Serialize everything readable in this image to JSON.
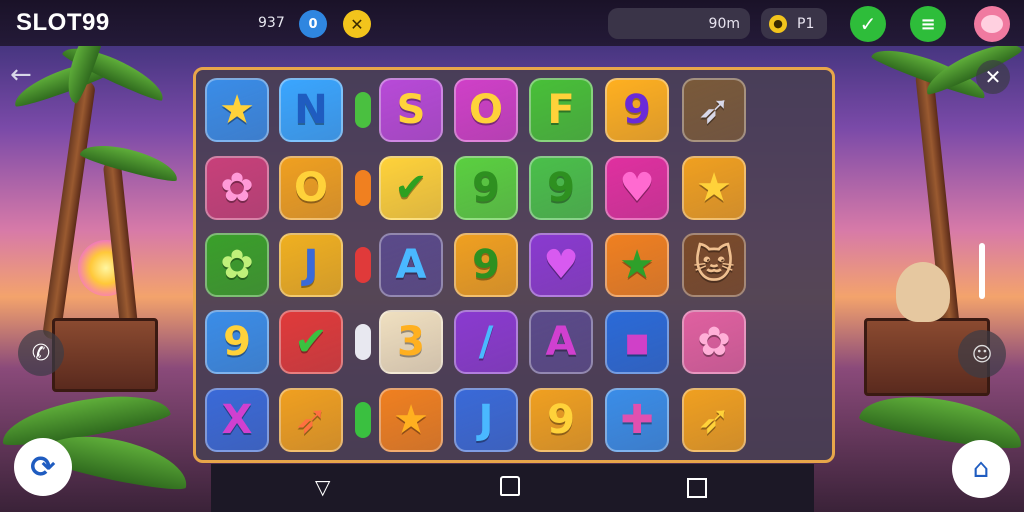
{
  "app": {
    "logo": "SLOT99"
  },
  "topbar": {
    "coin_count": "937",
    "blue_badge": "0",
    "balance": "90m",
    "message_label": "P1"
  },
  "icons": {
    "back": "arrow-left-icon",
    "close": "close-icon",
    "phone": "phone-icon",
    "refresh": "refresh-icon",
    "bag": "bag-icon",
    "check": "check-icon",
    "menu": "menu-icon",
    "avatar": "pig-avatar-icon"
  },
  "colors": {
    "accent_green": "#2ebd3a",
    "gold": "#e8a64a",
    "board": "#4a3f56"
  },
  "tiles": [
    [
      "★",
      "N",
      "",
      "S",
      "O",
      "F",
      "9",
      "➶"
    ],
    [
      "✿",
      "O",
      "",
      "✔",
      "9",
      "9",
      "♥",
      "★"
    ],
    [
      "✿",
      "J",
      "",
      "A",
      "9",
      "♥",
      "★",
      "🐱"
    ],
    [
      "9",
      "✔",
      "",
      "3",
      "/",
      "A",
      "▪",
      "✿"
    ],
    [
      "X",
      "➶",
      "",
      "★",
      "J",
      "9",
      "✚",
      "➶"
    ]
  ]
}
